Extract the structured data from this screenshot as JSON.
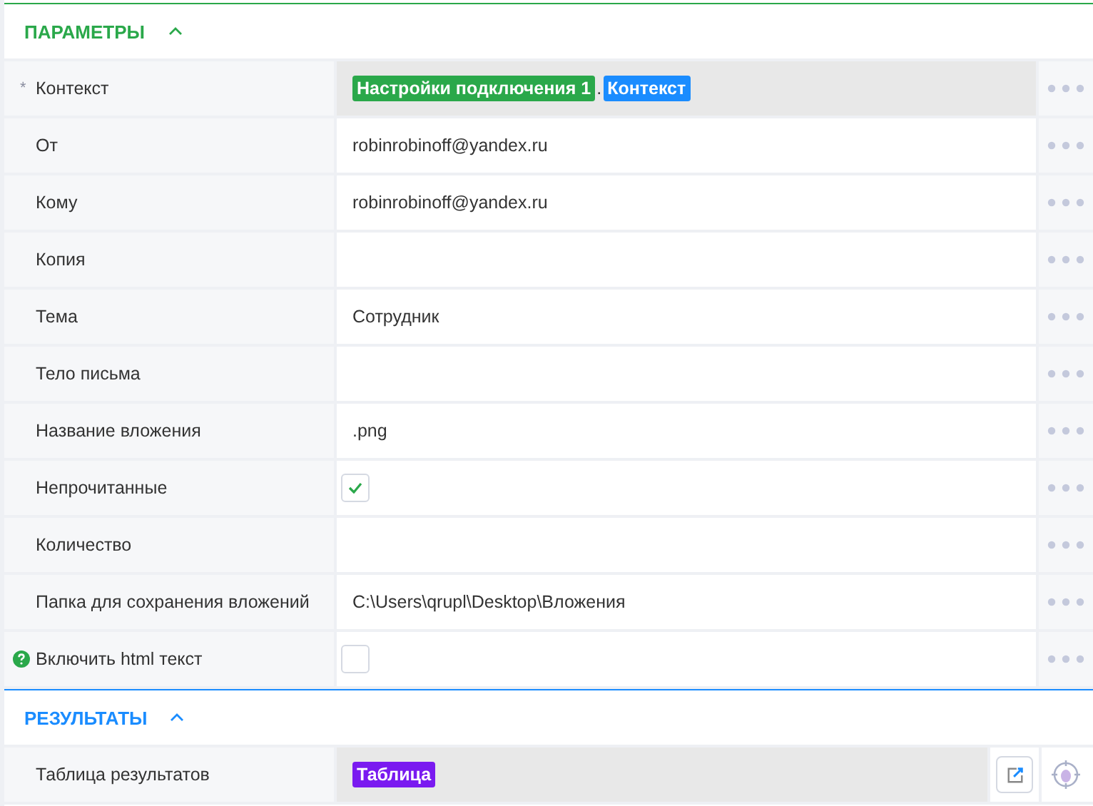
{
  "sections": [
    {
      "title": "ПАРАМЕТРЫ",
      "color": "#2aa84a",
      "expanded": true,
      "rows": [
        {
          "kind": "tags",
          "label": "Контекст",
          "marker": "*",
          "tags": [
            {
              "text": "Настройки подключения 1",
              "color": "#2aa84a"
            },
            {
              "text": "Контекст",
              "color": "#1a8cff"
            }
          ],
          "separator": "."
        },
        {
          "kind": "text",
          "label": "От",
          "value": "robinrobinoff@yandex.ru"
        },
        {
          "kind": "text",
          "label": "Кому",
          "value": "robinrobinoff@yandex.ru"
        },
        {
          "kind": "text",
          "label": "Копия"
        },
        {
          "kind": "text",
          "label": "Тема",
          "value": "Сотрудник"
        },
        {
          "kind": "text",
          "label": "Тело письма"
        },
        {
          "kind": "text",
          "label": "Название вложения",
          "value": ".png"
        },
        {
          "kind": "checkbox",
          "label": "Непрочитанные",
          "checked": true
        },
        {
          "kind": "text",
          "label": "Количество"
        },
        {
          "kind": "text",
          "label": "Папка для сохранения вложений",
          "value": "C:\\Users\\qrupl\\Desktop\\Вложения"
        },
        {
          "kind": "checkbox",
          "label": "Включить html текст",
          "help": true,
          "checked": false
        }
      ]
    },
    {
      "title": "РЕЗУЛЬТАТЫ",
      "color": "#1a8cff",
      "expanded": true,
      "rows": [
        {
          "kind": "output",
          "label": "Таблица результатов",
          "tags": [
            {
              "text": "Таблица",
              "color": "#7a1af0"
            }
          ]
        }
      ]
    }
  ]
}
